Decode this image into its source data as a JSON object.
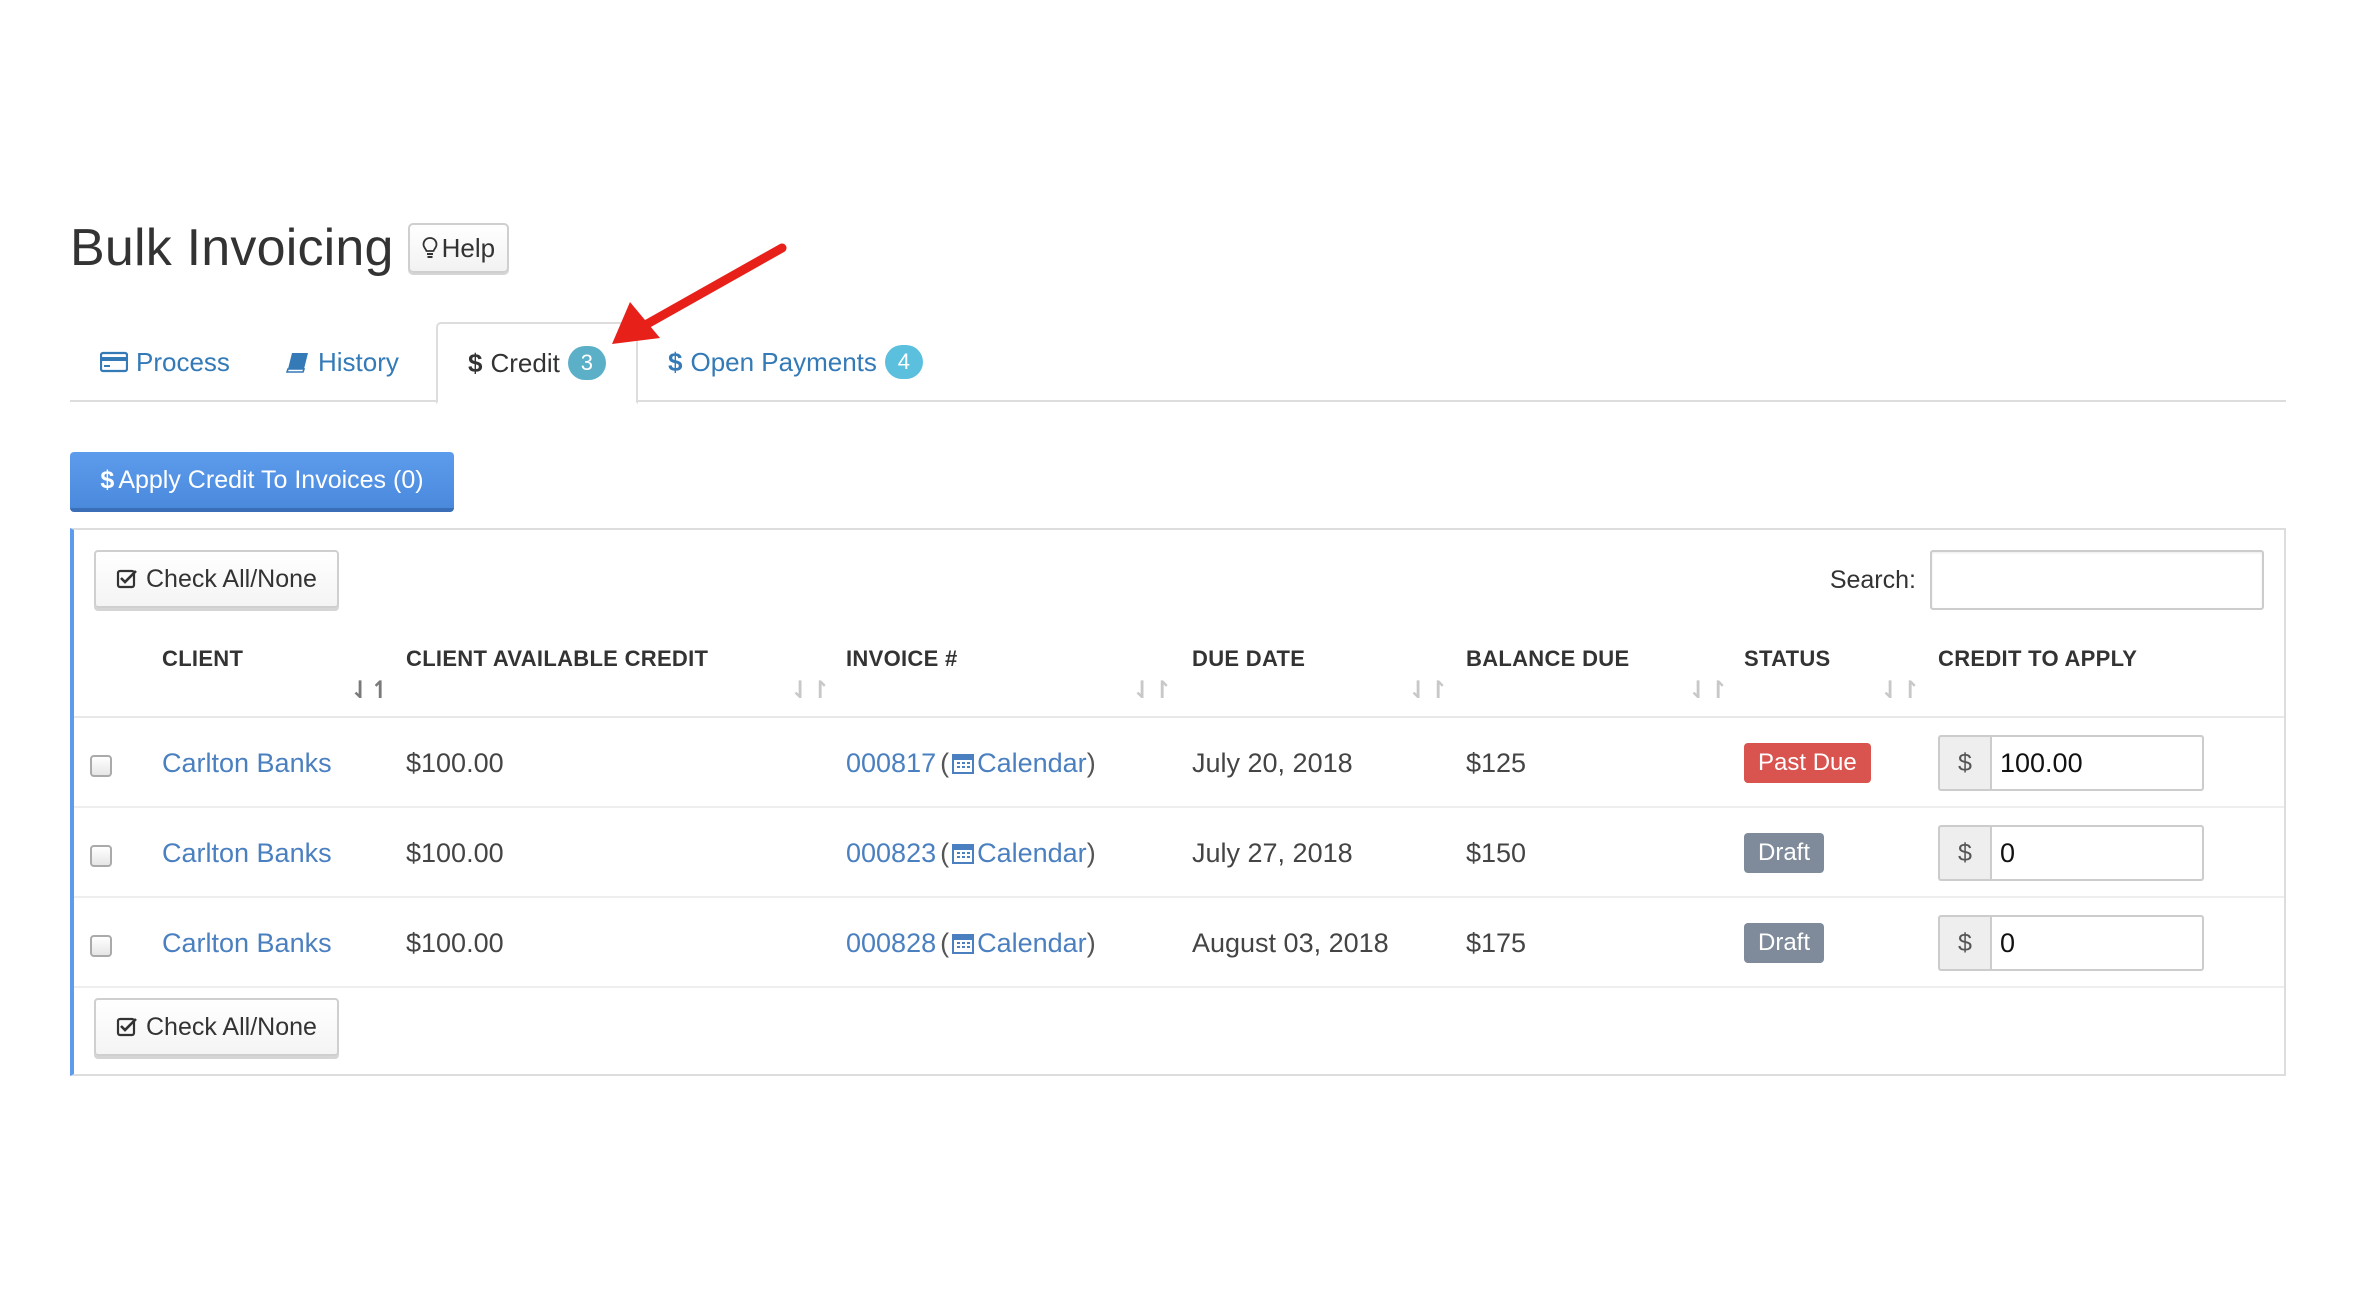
{
  "page": {
    "title": "Bulk Invoicing",
    "help_label": "Help"
  },
  "tabs": [
    {
      "label": "Process",
      "icon": "credit-card-icon",
      "active": false
    },
    {
      "label": "History",
      "icon": "book-icon",
      "active": false
    },
    {
      "label": "Credit",
      "icon": "dollar-icon",
      "badge": "3",
      "active": true
    },
    {
      "label": "Open Payments",
      "icon": "dollar-icon",
      "badge": "4",
      "active": false
    }
  ],
  "actions": {
    "apply_label": "Apply Credit To Invoices (0)",
    "apply_icon": "$",
    "check_all_label": "Check All/None"
  },
  "search": {
    "label": "Search:",
    "value": ""
  },
  "table": {
    "columns": [
      "CLIENT",
      "CLIENT AVAILABLE CREDIT",
      "INVOICE #",
      "DUE DATE",
      "BALANCE DUE",
      "STATUS",
      "CREDIT TO APPLY"
    ],
    "rows": [
      {
        "client": "Carlton Banks",
        "available_credit": "$100.00",
        "invoice_number": "000817",
        "calendar_label": "Calendar",
        "due_date": "July 20, 2018",
        "balance_due": "$125",
        "status": "Past Due",
        "credit_currency": "$",
        "credit_to_apply": "100.00"
      },
      {
        "client": "Carlton Banks",
        "available_credit": "$100.00",
        "invoice_number": "000823",
        "calendar_label": "Calendar",
        "due_date": "July 27, 2018",
        "balance_due": "$150",
        "status": "Draft",
        "credit_currency": "$",
        "credit_to_apply": "0"
      },
      {
        "client": "Carlton Banks",
        "available_credit": "$100.00",
        "invoice_number": "000828",
        "calendar_label": "Calendar",
        "due_date": "August 03, 2018",
        "balance_due": "$175",
        "status": "Draft",
        "credit_currency": "$",
        "credit_to_apply": "0"
      }
    ]
  },
  "colors": {
    "link": "#4a7fc0",
    "badge": "#5bc0de",
    "primary": "#4a89dc",
    "past_due": "#d9534f",
    "draft": "#7f8b9b",
    "annotation_arrow": "#e8201a"
  }
}
